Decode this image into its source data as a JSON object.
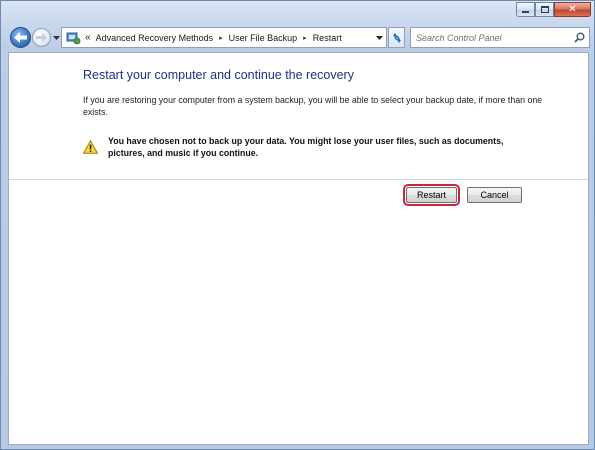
{
  "window": {
    "close_glyph": "✕"
  },
  "address_bar": {
    "overflow": "«",
    "separator": "▸",
    "breadcrumbs": [
      "Advanced Recovery Methods",
      "User File Backup",
      "Restart"
    ]
  },
  "search": {
    "placeholder": "Search Control Panel"
  },
  "content": {
    "title": "Restart your computer and continue the recovery",
    "description": "If you are restoring your computer from a system backup, you will be able to select your backup date, if more than one exists.",
    "warning": "You have chosen not to back up your data. You might lose your user files, such as documents, pictures, and music if you continue."
  },
  "buttons": {
    "restart": "Restart",
    "cancel": "Cancel"
  },
  "colors": {
    "title_text": "#1e3287",
    "highlight_outline": "#c9283b",
    "window_frame": "#bccde6"
  },
  "icons": {
    "back": "back-arrow-icon",
    "forward": "forward-arrow-icon",
    "recent": "chevron-down-icon",
    "control_panel": "control-panel-icon",
    "refresh": "refresh-icon",
    "search": "search-icon",
    "warning": "warning-icon"
  }
}
